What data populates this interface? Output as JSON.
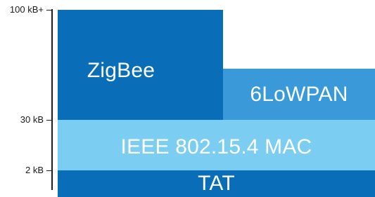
{
  "axis": {
    "ticks": [
      {
        "label": "100 kB+"
      },
      {
        "label": "30 kB"
      },
      {
        "label": "2 kB"
      }
    ]
  },
  "layers": {
    "zigbee": {
      "label": "ZigBee",
      "color": "#0a6db7"
    },
    "sixlowpan": {
      "label": "6LoWPAN",
      "color": "#3a9ad9"
    },
    "mac": {
      "label": "IEEE 802.15.4 MAC",
      "color": "#7ccdf2"
    },
    "tat": {
      "label": "TAT",
      "color": "#0a6db7"
    }
  }
}
